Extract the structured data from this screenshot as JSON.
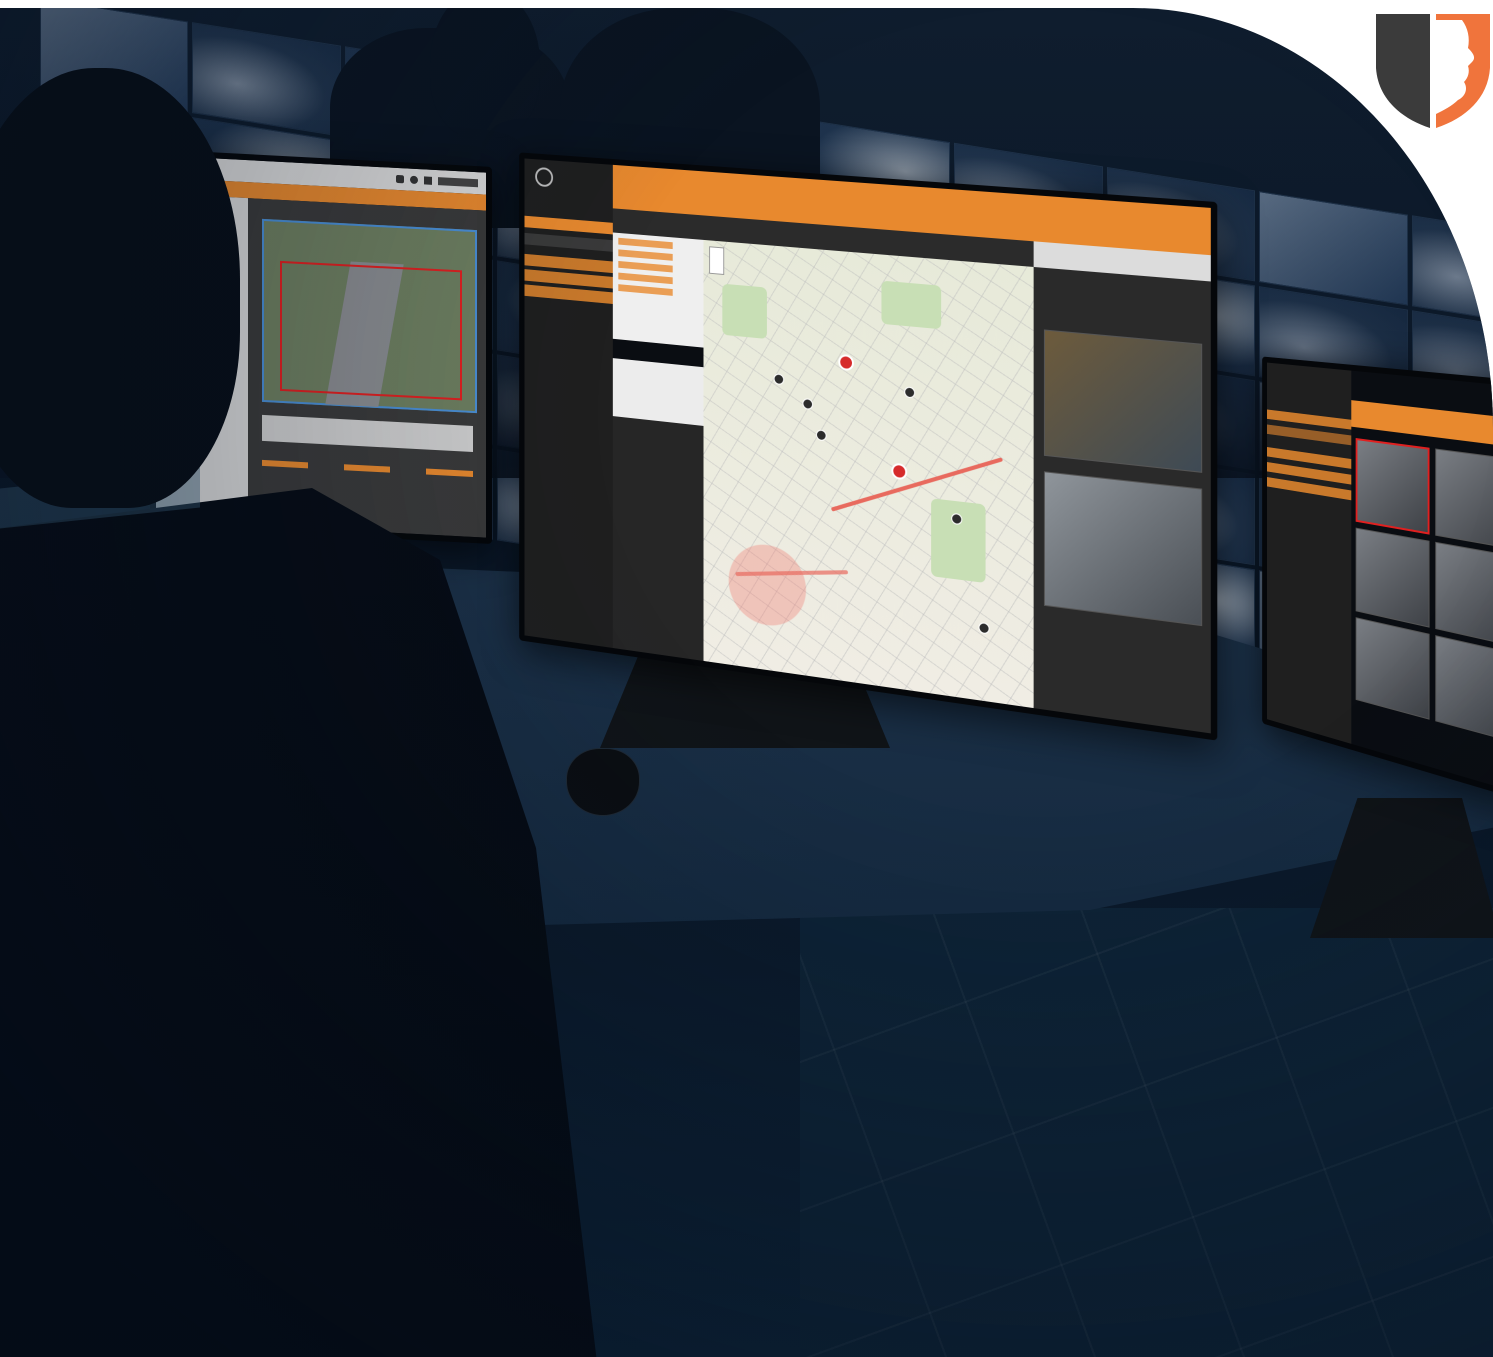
{
  "scene": {
    "colors": {
      "accent": "#e8892e",
      "shield_dark": "#3b3b3b",
      "shield_orange": "#f0743c",
      "alert_red": "#d62b2b",
      "camera_zone": "#e02020"
    }
  },
  "brand_logo": {
    "icon": "shield-face-logo-icon"
  }
}
